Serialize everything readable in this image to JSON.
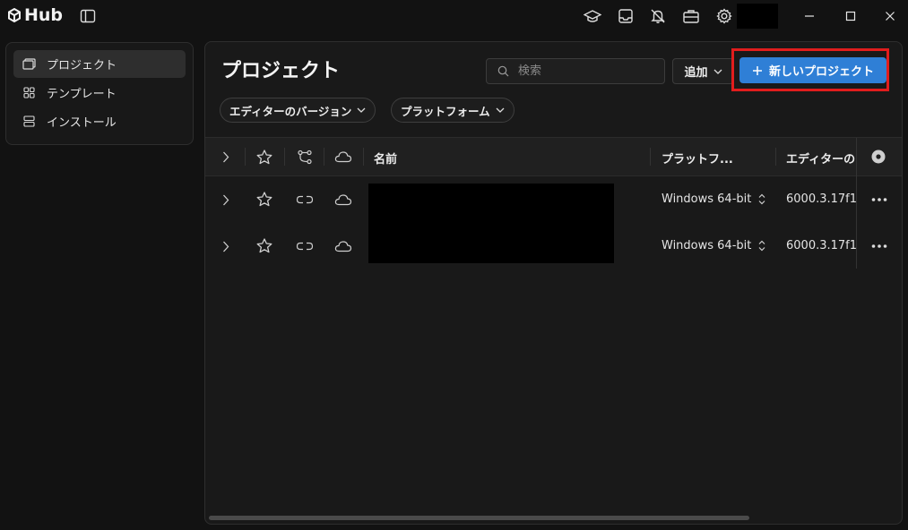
{
  "app": {
    "logo_text": "Hub"
  },
  "sidebar": {
    "items": [
      {
        "label": "プロジェクト",
        "icon": "projects-icon",
        "active": true
      },
      {
        "label": "テンプレート",
        "icon": "templates-icon",
        "active": false
      },
      {
        "label": "インストール",
        "icon": "installs-icon",
        "active": false
      }
    ]
  },
  "main": {
    "title": "プロジェクト",
    "search": {
      "placeholder": "検索",
      "value": ""
    },
    "add_label": "追加",
    "new_project_label": "新しいプロジェクト",
    "filters": [
      "エディターのバージョン",
      "プラットフォーム"
    ]
  },
  "table": {
    "headers": {
      "name": "名前",
      "platform": "プラットフ...",
      "editor": "エディターの"
    },
    "rows": [
      {
        "platform": "Windows 64-bit",
        "editor": "6000.3.17f1"
      },
      {
        "platform": "Windows 64-bit",
        "editor": "6000.3.17f1"
      }
    ]
  },
  "colors": {
    "accent": "#2f7fd6",
    "highlight": "#e11d1d",
    "background": "#121212",
    "panel": "#191919"
  }
}
